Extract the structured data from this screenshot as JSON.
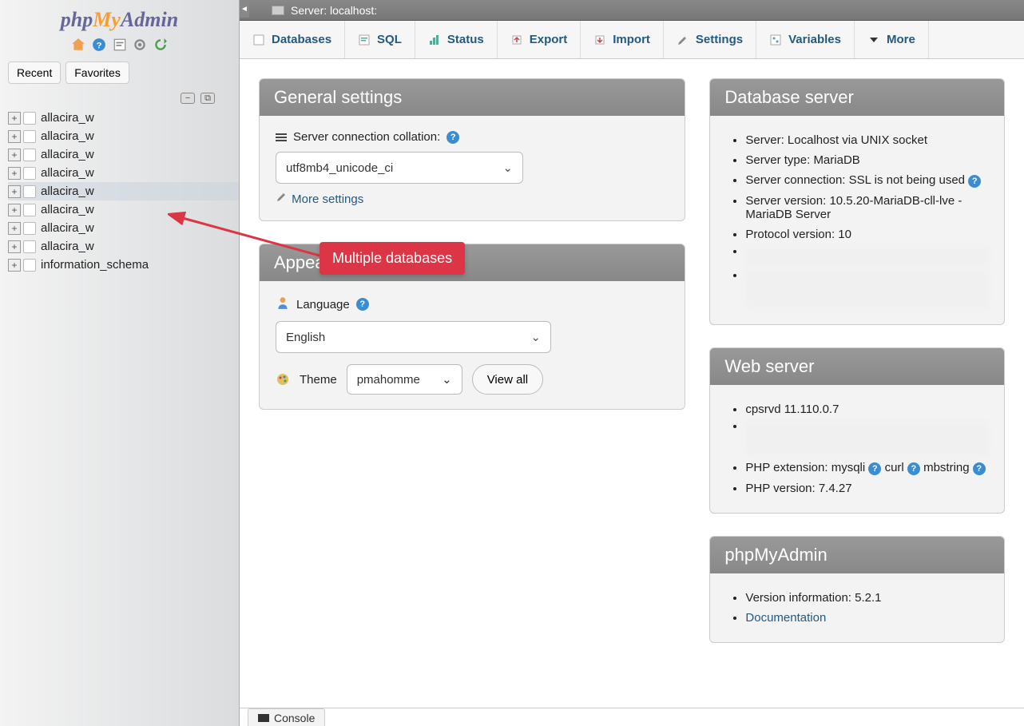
{
  "logo": {
    "part1": "php",
    "part2": "My",
    "part3": "Admin"
  },
  "sidebar": {
    "tabs": {
      "recent": "Recent",
      "favorites": "Favorites"
    },
    "databases": [
      "allacira_w",
      "allacira_w",
      "allacira_w",
      "allacira_w",
      "allacira_w",
      "allacira_w",
      "allacira_w",
      "allacira_w",
      "information_schema"
    ]
  },
  "topbar": {
    "label": "Server: localhost:"
  },
  "menu": {
    "databases": "Databases",
    "sql": "SQL",
    "status": "Status",
    "export": "Export",
    "import": "Import",
    "settings": "Settings",
    "variables": "Variables",
    "more": "More"
  },
  "general": {
    "title": "General settings",
    "collation_label": "Server connection collation:",
    "collation_value": "utf8mb4_unicode_ci",
    "more_settings": "More settings"
  },
  "appearance": {
    "title": "Appearance settings",
    "language_label": "Language",
    "language_value": "English",
    "theme_label": "Theme",
    "theme_value": "pmahomme",
    "view_all": "View all"
  },
  "dbserver": {
    "title": "Database server",
    "items": [
      "Server: Localhost via UNIX socket",
      "Server type: MariaDB",
      "Server connection: SSL is not being used",
      "Server version: 10.5.20-MariaDB-cll-lve - MariaDB Server",
      "Protocol version: 10"
    ]
  },
  "webserver": {
    "title": "Web server",
    "item1": "cpsrvd 11.110.0.7",
    "php_ext_label": "PHP extension:",
    "php_ext1": "mysqli",
    "php_ext2": "curl",
    "php_ext3": "mbstring",
    "php_version": "PHP version: 7.4.27"
  },
  "pma": {
    "title": "phpMyAdmin",
    "version": "Version information: 5.2.1",
    "documentation": "Documentation"
  },
  "annotation": "Multiple databases",
  "console": "Console"
}
